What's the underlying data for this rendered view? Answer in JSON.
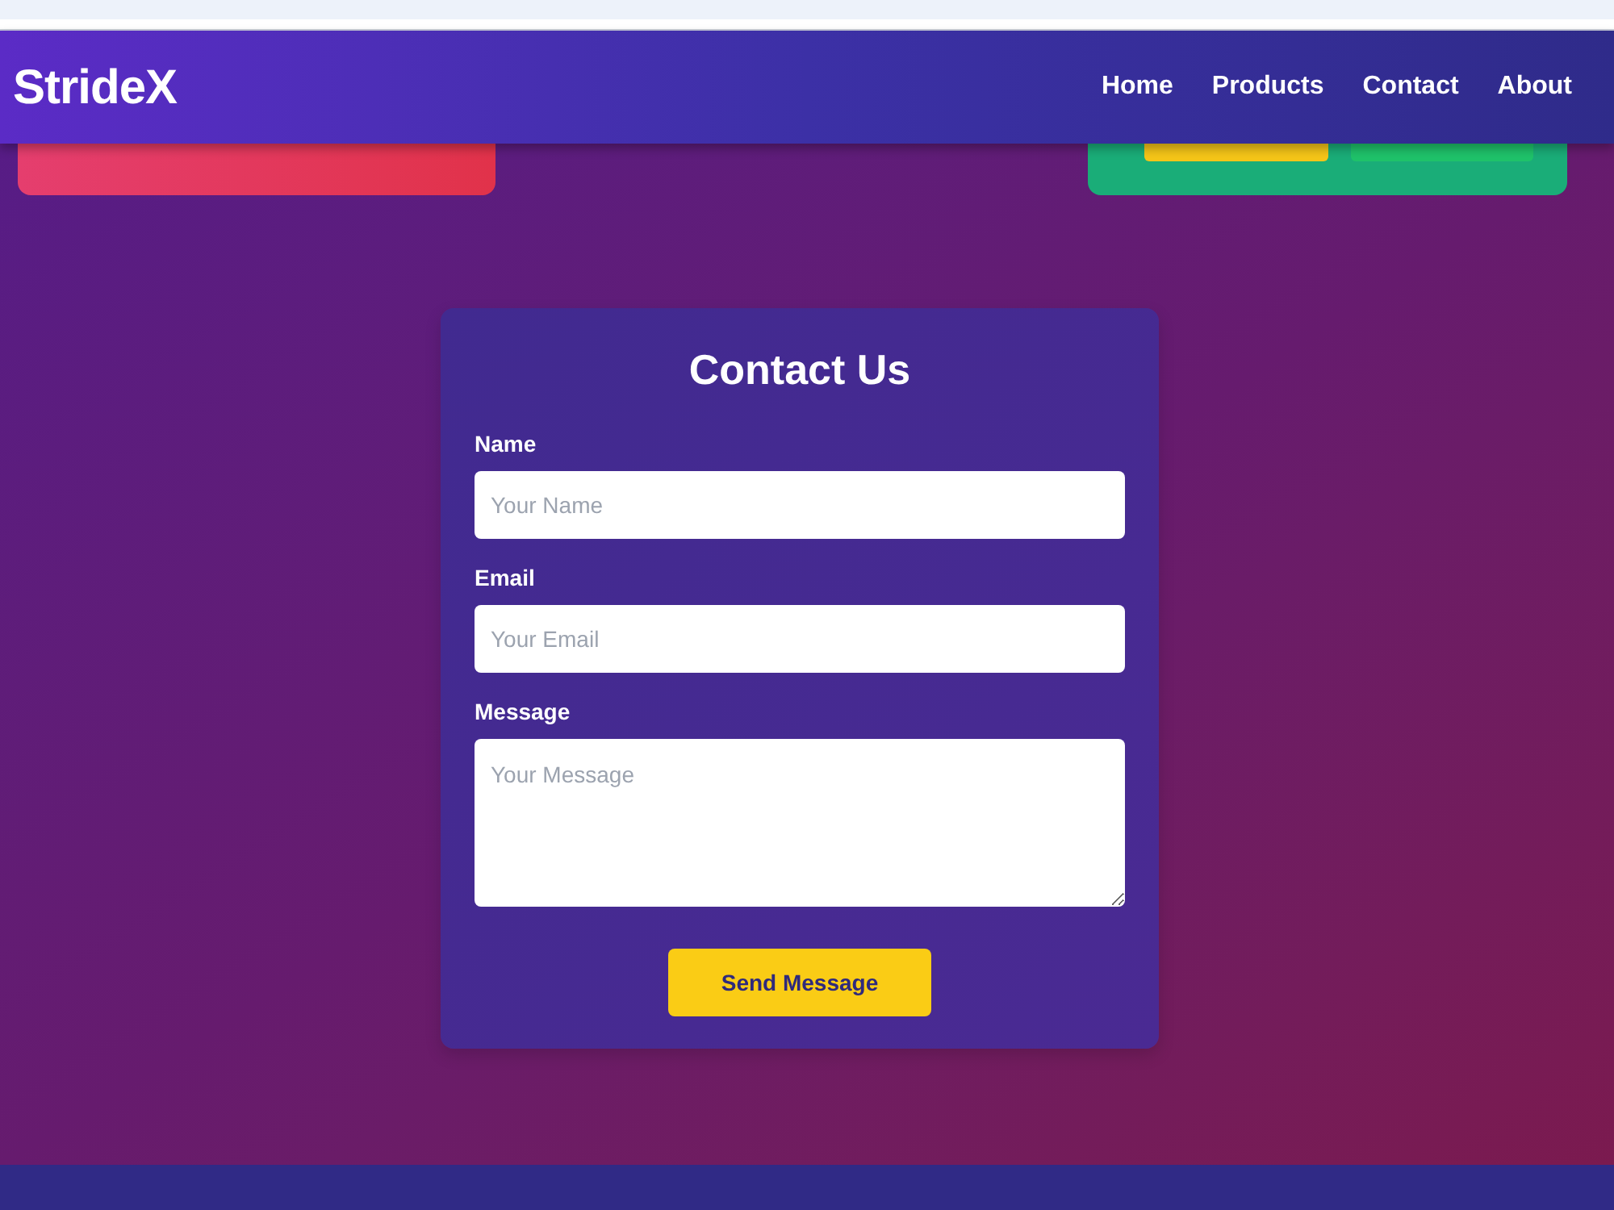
{
  "navbar": {
    "brand": "StrideX",
    "links": [
      {
        "label": "Home"
      },
      {
        "label": "Products"
      },
      {
        "label": "Contact"
      },
      {
        "label": "About"
      }
    ]
  },
  "contact_form": {
    "title": "Contact Us",
    "fields": [
      {
        "kind": "input",
        "label": "Name",
        "placeholder": "Your Name"
      },
      {
        "kind": "input",
        "label": "Email",
        "placeholder": "Your Email"
      },
      {
        "kind": "textarea",
        "label": "Message",
        "placeholder": "Your Message"
      }
    ],
    "submit": "Send Message"
  }
}
